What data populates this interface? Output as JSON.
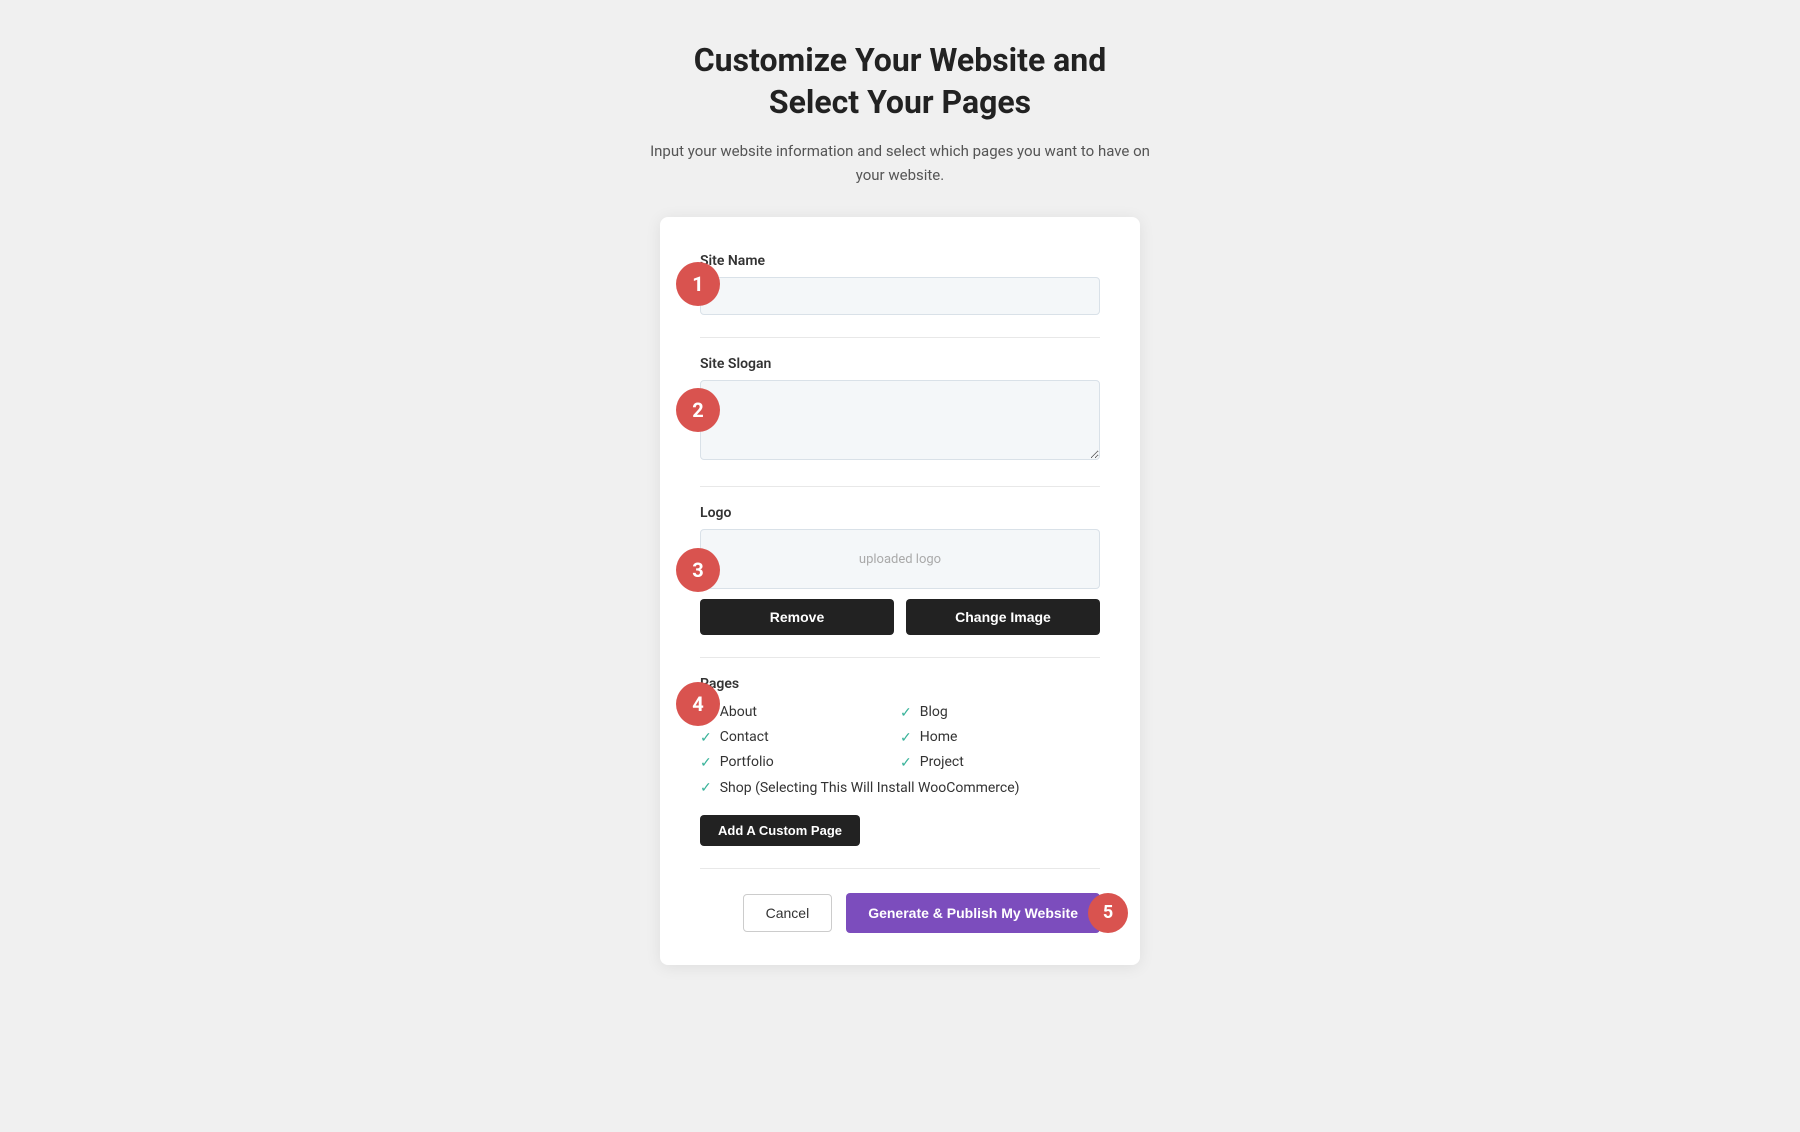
{
  "header": {
    "title_line1": "Customize Your Website and",
    "title_line2": "Select Your Pages",
    "subtitle": "Input your website information and select which pages you want to have on your website."
  },
  "card": {
    "site_name_label": "Site Name",
    "site_name_placeholder": "",
    "site_slogan_label": "Site Slogan",
    "site_slogan_placeholder": "",
    "logo_label": "Logo",
    "logo_preview_text": "uploaded logo",
    "remove_button": "Remove",
    "change_image_button": "Change Image",
    "pages_label": "Pages",
    "pages": [
      {
        "name": "About",
        "checked": true
      },
      {
        "name": "Blog",
        "checked": true
      },
      {
        "name": "Contact",
        "checked": true
      },
      {
        "name": "Home",
        "checked": true
      },
      {
        "name": "Portfolio",
        "checked": true
      },
      {
        "name": "Project",
        "checked": true
      }
    ],
    "shop_page": {
      "name": "Shop (Selecting This Will Install WooCommerce)",
      "checked": true
    },
    "add_custom_page_button": "Add A Custom Page",
    "cancel_button": "Cancel",
    "publish_button": "Generate & Publish My Website"
  },
  "steps": {
    "step1": "1",
    "step2": "2",
    "step3": "3",
    "step4": "4",
    "step5": "5"
  }
}
